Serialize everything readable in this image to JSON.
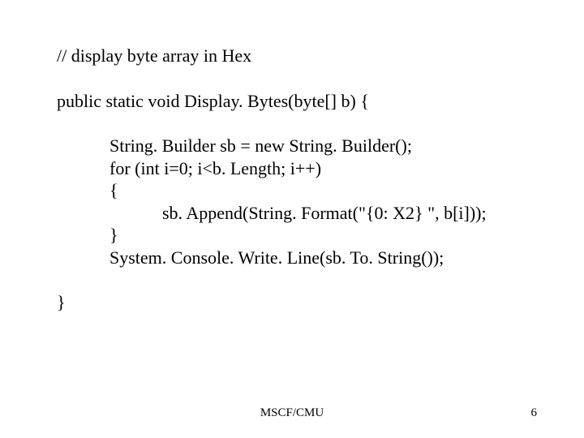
{
  "code": {
    "l1": "// display byte array in Hex",
    "l2": "public static void Display. Bytes(byte[] b) {",
    "l3": "String. Builder sb = new String. Builder();",
    "l4": "for (int i=0; i<b. Length; i++)",
    "l5": "{",
    "l6": "sb. Append(String. Format(\"{0: X2} \", b[i]));",
    "l7": "}",
    "l8": "System. Console. Write. Line(sb. To. String());",
    "l9": "}"
  },
  "footer": {
    "center": "MSCF/CMU",
    "page": "6"
  }
}
